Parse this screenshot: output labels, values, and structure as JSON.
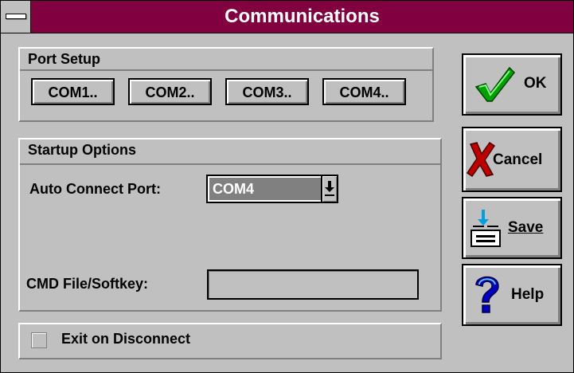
{
  "window": {
    "title": "Communications"
  },
  "port_setup": {
    "heading": "Port Setup",
    "ports": [
      "COM1..",
      "COM2..",
      "COM3..",
      "COM4.."
    ]
  },
  "startup_options": {
    "heading": "Startup Options",
    "auto_connect_label": "Auto Connect Port:",
    "auto_connect_value": "COM4",
    "cmd_file_label": "CMD File/Softkey:",
    "cmd_file_value": ""
  },
  "exit_on_disconnect": {
    "label": "Exit on Disconnect",
    "checked": false
  },
  "buttons": {
    "ok": "OK",
    "cancel": "Cancel",
    "save": "Save",
    "help": "Help"
  },
  "icons": {
    "ok": "checkmark-icon",
    "cancel": "x-mark-icon",
    "save": "save-disk-icon",
    "help": "question-mark-icon"
  },
  "colors": {
    "titlebar": "#800040",
    "face": "#c0c0c0",
    "check_green": "#00a000",
    "cancel_red": "#c00000",
    "help_blue": "#0000c0"
  }
}
